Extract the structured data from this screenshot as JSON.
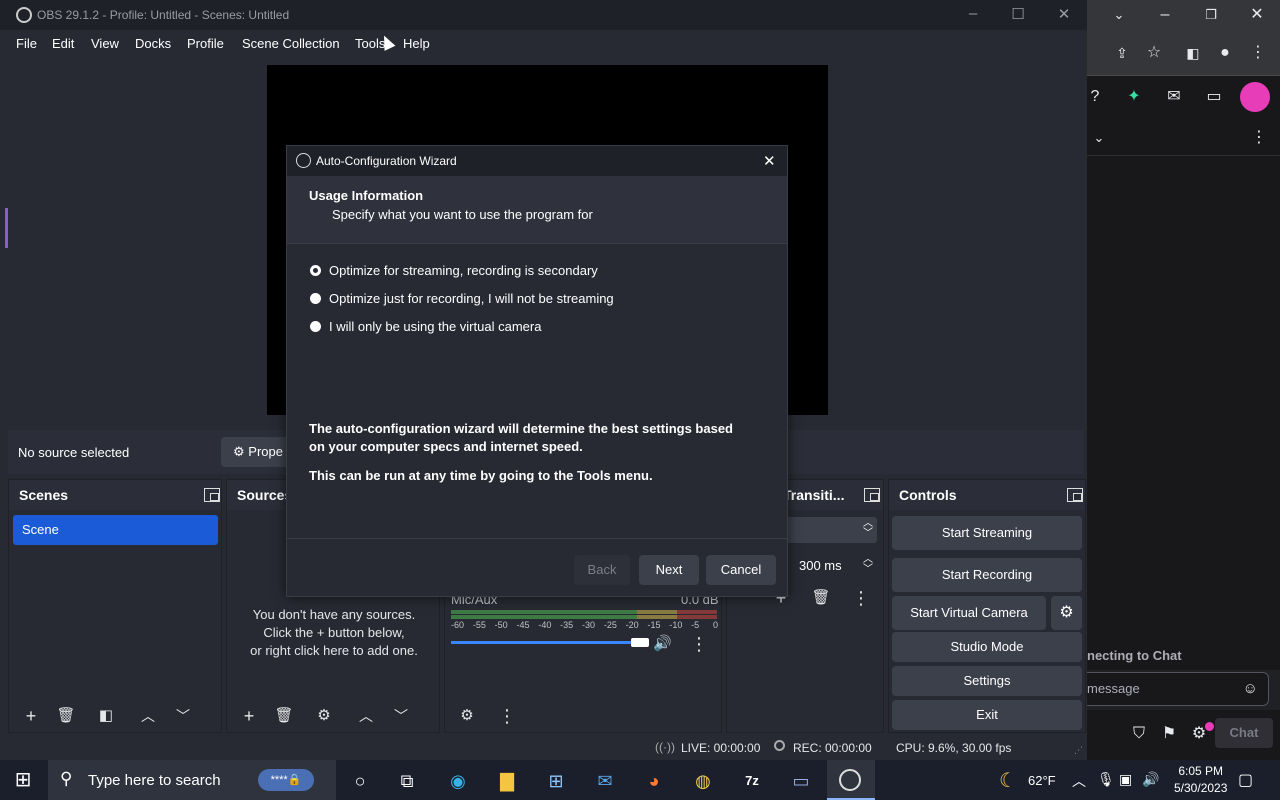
{
  "obs": {
    "title": "OBS 29.1.2 - Profile: Untitled - Scenes: Untitled",
    "menu": [
      "File",
      "Edit",
      "View",
      "Docks",
      "Profile",
      "Scene Collection",
      "Tools",
      "Help"
    ],
    "context": {
      "no_source": "No source selected",
      "properties": "Prope"
    },
    "scenes": {
      "title": "Scenes",
      "items": [
        "Scene"
      ]
    },
    "sources": {
      "title": "Sources",
      "empty_line1": "You don't have any sources.",
      "empty_line2": "Click the + button below,",
      "empty_line3": "or right click here to add one."
    },
    "mixer": {
      "channel": "Mic/Aux",
      "db": "0.0 dB",
      "ticks": [
        "-60",
        "-55",
        "-50",
        "-45",
        "-40",
        "-35",
        "-30",
        "-25",
        "-20",
        "-15",
        "-10",
        "-5",
        "0"
      ]
    },
    "transitions": {
      "title": "Transiti...",
      "duration": "300 ms"
    },
    "controls": {
      "title": "Controls",
      "start_streaming": "Start Streaming",
      "start_recording": "Start Recording",
      "start_virtual_camera": "Start Virtual Camera",
      "studio_mode": "Studio Mode",
      "settings": "Settings",
      "exit": "Exit"
    },
    "status": {
      "live": "LIVE: 00:00:00",
      "rec": "REC: 00:00:00",
      "cpu": "CPU: 9.6%, 30.00 fps"
    }
  },
  "wizard": {
    "title": "Auto-Configuration Wizard",
    "heading": "Usage Information",
    "subheading": "Specify what you want to use the program for",
    "options": [
      "Optimize for streaming, recording is secondary",
      "Optimize just for recording, I will not be streaming",
      "I will only be using the virtual camera"
    ],
    "selected_option": 0,
    "info_line1": "The auto-configuration wizard will determine the best settings based",
    "info_line2": "on your computer specs and internet speed.",
    "info_line3": "This can be run at any time by going to the Tools menu.",
    "back": "Back",
    "next": "Next",
    "cancel": "Cancel"
  },
  "browser": {
    "chat_status": "necting to Chat",
    "chat_placeholder": "message",
    "chat_button": "Chat"
  },
  "taskbar": {
    "search_placeholder": "Type here to search",
    "temperature": "62°F",
    "time": "6:05 PM",
    "date": "5/30/2023"
  },
  "colors": {
    "obs_bg": "#272a33",
    "scene_selected": "#1c5bd8",
    "twitch_avatar": "#e83db8",
    "meter_green": "#4caf50"
  }
}
